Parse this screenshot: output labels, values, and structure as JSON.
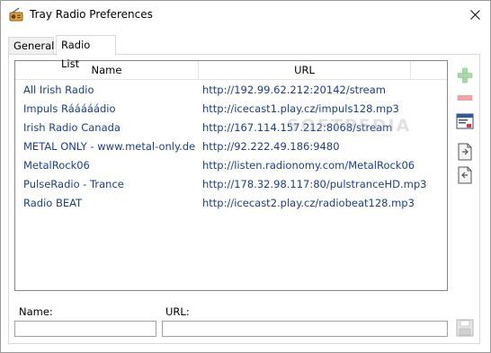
{
  "window": {
    "title": "Tray Radio Preferences"
  },
  "tabs": [
    {
      "label": "General"
    },
    {
      "label": "Radio List"
    }
  ],
  "list": {
    "columns": {
      "name": "Name",
      "url": "URL"
    },
    "rows": [
      {
        "name": "All Irish Radio",
        "url": "http://192.99.62.212:20142/stream"
      },
      {
        "name": "Impuls Rááááádio",
        "url": "http://icecast1.play.cz/impuls128.mp3"
      },
      {
        "name": "Irish Radio Canada",
        "url": "http://167.114.157.212:8068/stream"
      },
      {
        "name": "METAL ONLY - www.metal-only.de -",
        "url": "http://92.222.49.186:9480"
      },
      {
        "name": "MetalRock06",
        "url": "http://listen.radionomy.com/MetalRock06"
      },
      {
        "name": "PulseRadio - Trance",
        "url": "http://178.32.98.117:80/pulstranceHD.mp3"
      },
      {
        "name": "Radio BEAT",
        "url": "http://icecast2.play.cz/radiobeat128.mp3"
      }
    ]
  },
  "form": {
    "name_label": "Name:",
    "url_label": "URL:",
    "name_value": "",
    "url_value": ""
  },
  "watermark": "SOFTPEDIA",
  "colors": {
    "row_text": "#1a3f8a",
    "add_icon": "#8fd18f",
    "remove_icon": "#f08a8a"
  }
}
